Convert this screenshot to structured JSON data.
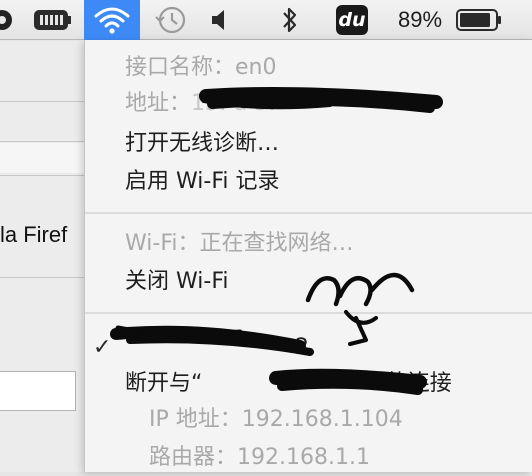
{
  "menubar": {
    "icons": [
      "app-icon",
      "battery-app-icon",
      "wifi-icon",
      "time-machine-icon",
      "volume-icon",
      "bluetooth-icon",
      "du-app-icon",
      "battery-icon"
    ],
    "du_label": "du",
    "battery_percent": "89%",
    "battery_level": 0.89,
    "accent_color": "#3d8af7"
  },
  "background_window": {
    "title_partial": "la Firef"
  },
  "wifi_menu": {
    "interface_name": "接口名称：en0",
    "address_label": "地址：",
    "address_value_visible": "15:  d  3:  ",
    "open_diagnostics": "打开无线诊断…",
    "enable_logging": "启用 Wi-Fi 记录",
    "wifi_status": "Wi-Fi：正在查找网络…",
    "turn_off_wifi": "关闭 Wi-Fi",
    "connected_network_suffix": "2",
    "connected_check": "✓",
    "disconnect_prefix": "断开与“",
    "disconnect_suffix": "”的连接",
    "ip_label": "IP 地址：",
    "ip_value": "192.168.1.104",
    "router_label": "路由器：",
    "router_value": "192.168.1.1"
  }
}
